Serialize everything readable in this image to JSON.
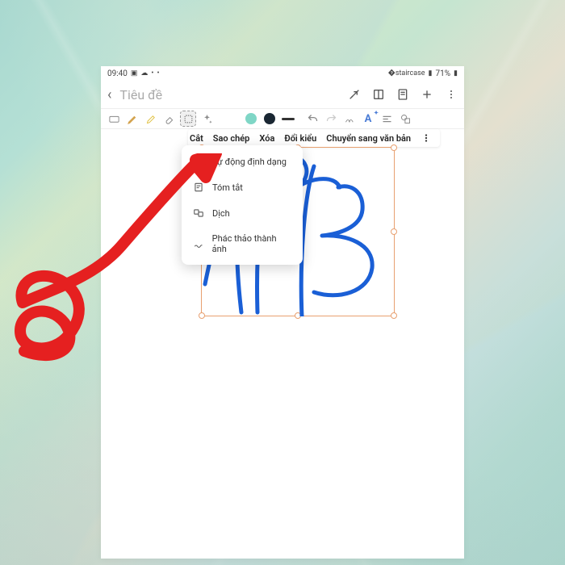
{
  "statusbar": {
    "time": "09:40",
    "battery": "71%"
  },
  "titlebar": {
    "title": "Tiêu đề"
  },
  "toolbar": {
    "colors": {
      "c1": "#e08a8a",
      "c2": "#7fd6c6",
      "c3": "#1a2733"
    }
  },
  "context_menu": {
    "cut": "Cắt",
    "copy": "Sao chép",
    "delete": "Xóa",
    "change_style": "Đổi kiểu",
    "to_text": "Chuyển sang văn bản"
  },
  "dropdown": {
    "autoformat": "Tự động định dạng",
    "summarize": "Tóm tắt",
    "translate": "Dịch",
    "sketch_to_image": "Phác thảo thành ảnh"
  }
}
